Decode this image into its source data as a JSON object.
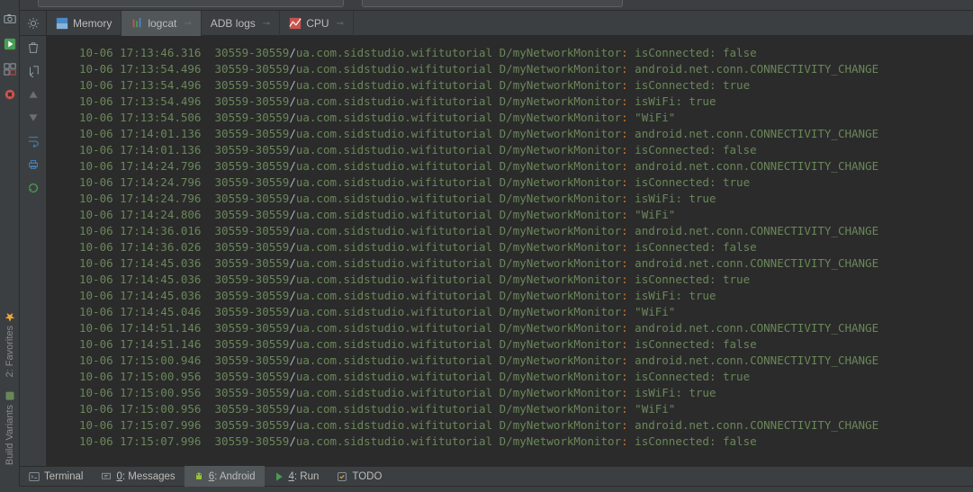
{
  "tabs": {
    "memory": "Memory",
    "logcat": "logcat",
    "adb": "ADB logs",
    "cpu": "CPU"
  },
  "bottom": {
    "terminal": "Terminal",
    "messages": "Messages",
    "messages_key": "0",
    "android": "Android",
    "android_key": "6",
    "run": "Run",
    "run_key": "4",
    "todo": "TODO"
  },
  "left_labels": {
    "favorites": "2: Favorites",
    "build": "Build Variants"
  },
  "logs": [
    {
      "dt": "10-06 17:13:46.316",
      "pid": "30559-30559",
      "pkg": "ua.com.sidstudio.wifitutorial",
      "tag": "D/myNetworkMonitor",
      "msg": "isConnected: false"
    },
    {
      "dt": "10-06 17:13:54.496",
      "pid": "30559-30559",
      "pkg": "ua.com.sidstudio.wifitutorial",
      "tag": "D/myNetworkMonitor",
      "msg": "android.net.conn.CONNECTIVITY_CHANGE"
    },
    {
      "dt": "10-06 17:13:54.496",
      "pid": "30559-30559",
      "pkg": "ua.com.sidstudio.wifitutorial",
      "tag": "D/myNetworkMonitor",
      "msg": "isConnected: true"
    },
    {
      "dt": "10-06 17:13:54.496",
      "pid": "30559-30559",
      "pkg": "ua.com.sidstudio.wifitutorial",
      "tag": "D/myNetworkMonitor",
      "msg": "isWiFi: true"
    },
    {
      "dt": "10-06 17:13:54.506",
      "pid": "30559-30559",
      "pkg": "ua.com.sidstudio.wifitutorial",
      "tag": "D/myNetworkMonitor",
      "msg": "\"WiFi\""
    },
    {
      "dt": "10-06 17:14:01.136",
      "pid": "30559-30559",
      "pkg": "ua.com.sidstudio.wifitutorial",
      "tag": "D/myNetworkMonitor",
      "msg": "android.net.conn.CONNECTIVITY_CHANGE"
    },
    {
      "dt": "10-06 17:14:01.136",
      "pid": "30559-30559",
      "pkg": "ua.com.sidstudio.wifitutorial",
      "tag": "D/myNetworkMonitor",
      "msg": "isConnected: false"
    },
    {
      "dt": "10-06 17:14:24.796",
      "pid": "30559-30559",
      "pkg": "ua.com.sidstudio.wifitutorial",
      "tag": "D/myNetworkMonitor",
      "msg": "android.net.conn.CONNECTIVITY_CHANGE"
    },
    {
      "dt": "10-06 17:14:24.796",
      "pid": "30559-30559",
      "pkg": "ua.com.sidstudio.wifitutorial",
      "tag": "D/myNetworkMonitor",
      "msg": "isConnected: true"
    },
    {
      "dt": "10-06 17:14:24.796",
      "pid": "30559-30559",
      "pkg": "ua.com.sidstudio.wifitutorial",
      "tag": "D/myNetworkMonitor",
      "msg": "isWiFi: true"
    },
    {
      "dt": "10-06 17:14:24.806",
      "pid": "30559-30559",
      "pkg": "ua.com.sidstudio.wifitutorial",
      "tag": "D/myNetworkMonitor",
      "msg": "\"WiFi\""
    },
    {
      "dt": "10-06 17:14:36.016",
      "pid": "30559-30559",
      "pkg": "ua.com.sidstudio.wifitutorial",
      "tag": "D/myNetworkMonitor",
      "msg": "android.net.conn.CONNECTIVITY_CHANGE"
    },
    {
      "dt": "10-06 17:14:36.026",
      "pid": "30559-30559",
      "pkg": "ua.com.sidstudio.wifitutorial",
      "tag": "D/myNetworkMonitor",
      "msg": "isConnected: false"
    },
    {
      "dt": "10-06 17:14:45.036",
      "pid": "30559-30559",
      "pkg": "ua.com.sidstudio.wifitutorial",
      "tag": "D/myNetworkMonitor",
      "msg": "android.net.conn.CONNECTIVITY_CHANGE"
    },
    {
      "dt": "10-06 17:14:45.036",
      "pid": "30559-30559",
      "pkg": "ua.com.sidstudio.wifitutorial",
      "tag": "D/myNetworkMonitor",
      "msg": "isConnected: true"
    },
    {
      "dt": "10-06 17:14:45.036",
      "pid": "30559-30559",
      "pkg": "ua.com.sidstudio.wifitutorial",
      "tag": "D/myNetworkMonitor",
      "msg": "isWiFi: true"
    },
    {
      "dt": "10-06 17:14:45.046",
      "pid": "30559-30559",
      "pkg": "ua.com.sidstudio.wifitutorial",
      "tag": "D/myNetworkMonitor",
      "msg": "\"WiFi\""
    },
    {
      "dt": "10-06 17:14:51.146",
      "pid": "30559-30559",
      "pkg": "ua.com.sidstudio.wifitutorial",
      "tag": "D/myNetworkMonitor",
      "msg": "android.net.conn.CONNECTIVITY_CHANGE"
    },
    {
      "dt": "10-06 17:14:51.146",
      "pid": "30559-30559",
      "pkg": "ua.com.sidstudio.wifitutorial",
      "tag": "D/myNetworkMonitor",
      "msg": "isConnected: false"
    },
    {
      "dt": "10-06 17:15:00.946",
      "pid": "30559-30559",
      "pkg": "ua.com.sidstudio.wifitutorial",
      "tag": "D/myNetworkMonitor",
      "msg": "android.net.conn.CONNECTIVITY_CHANGE"
    },
    {
      "dt": "10-06 17:15:00.956",
      "pid": "30559-30559",
      "pkg": "ua.com.sidstudio.wifitutorial",
      "tag": "D/myNetworkMonitor",
      "msg": "isConnected: true"
    },
    {
      "dt": "10-06 17:15:00.956",
      "pid": "30559-30559",
      "pkg": "ua.com.sidstudio.wifitutorial",
      "tag": "D/myNetworkMonitor",
      "msg": "isWiFi: true"
    },
    {
      "dt": "10-06 17:15:00.956",
      "pid": "30559-30559",
      "pkg": "ua.com.sidstudio.wifitutorial",
      "tag": "D/myNetworkMonitor",
      "msg": "\"WiFi\""
    },
    {
      "dt": "10-06 17:15:07.996",
      "pid": "30559-30559",
      "pkg": "ua.com.sidstudio.wifitutorial",
      "tag": "D/myNetworkMonitor",
      "msg": "android.net.conn.CONNECTIVITY_CHANGE"
    },
    {
      "dt": "10-06 17:15:07.996",
      "pid": "30559-30559",
      "pkg": "ua.com.sidstudio.wifitutorial",
      "tag": "D/myNetworkMonitor",
      "msg": "isConnected: false"
    }
  ]
}
